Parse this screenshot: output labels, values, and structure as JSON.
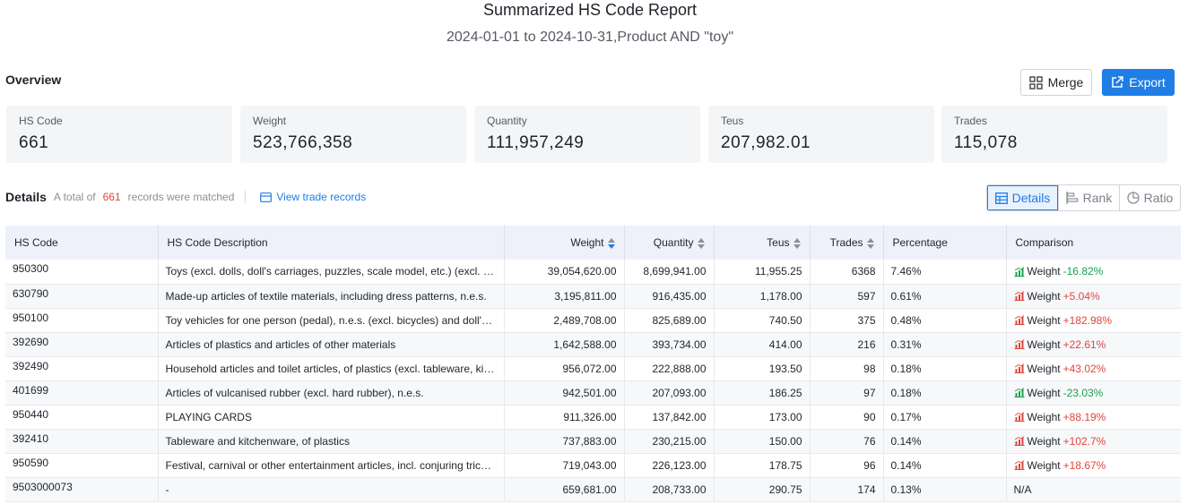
{
  "report": {
    "title": "Summarized HS Code Report",
    "subtitle": "2024-01-01 to 2024-10-31,Product AND \"toy\""
  },
  "overview": {
    "label": "Overview",
    "merge_label": "Merge",
    "export_label": "Export",
    "stats": [
      {
        "label": "HS Code",
        "value": "661"
      },
      {
        "label": "Weight",
        "value": "523,766,358"
      },
      {
        "label": "Quantity",
        "value": "111,957,249"
      },
      {
        "label": "Teus",
        "value": "207,982.01"
      },
      {
        "label": "Trades",
        "value": "115,078"
      }
    ]
  },
  "details": {
    "title": "Details",
    "total_prefix": "A total of",
    "total_count": "661",
    "total_suffix": "records were matched",
    "view_link": "View trade records",
    "views": [
      "Details",
      "Rank",
      "Ratio"
    ]
  },
  "table": {
    "headers": [
      "HS Code",
      "HS Code Description",
      "Weight",
      "Quantity",
      "Teus",
      "Trades",
      "Percentage",
      "Comparison"
    ],
    "rows": [
      {
        "code": "950300",
        "desc": "Toys (excl. dolls, doll's carriages, puzzles, scale model, etc.) (excl. games, etc.)",
        "weight": "39,054,620.00",
        "quantity": "8,699,941.00",
        "teus": "11,955.25",
        "trades": "6368",
        "pct": "7.46%",
        "cmp_label": "Weight",
        "cmp": "-16.82%",
        "trend": "down"
      },
      {
        "code": "630790",
        "desc": "Made-up articles of textile materials, including dress patterns, n.e.s.",
        "weight": "3,195,811.00",
        "quantity": "916,435.00",
        "teus": "1,178.00",
        "trades": "597",
        "pct": "0.61%",
        "cmp_label": "Weight",
        "cmp": "+5.04%",
        "trend": "up"
      },
      {
        "code": "950100",
        "desc": "Toy vehicles for one person (pedal), n.e.s. (excl. bicycles) and doll's carriages",
        "weight": "2,489,708.00",
        "quantity": "825,689.00",
        "teus": "740.50",
        "trades": "375",
        "pct": "0.48%",
        "cmp_label": "Weight",
        "cmp": "+182.98%",
        "trend": "up"
      },
      {
        "code": "392690",
        "desc": "Articles of plastics and articles of other materials",
        "weight": "1,642,588.00",
        "quantity": "393,734.00",
        "teus": "414.00",
        "trades": "216",
        "pct": "0.31%",
        "cmp_label": "Weight",
        "cmp": "+22.61%",
        "trend": "up"
      },
      {
        "code": "392490",
        "desc": "Household articles and toilet articles, of plastics (excl. tableware, kitchenware)",
        "weight": "956,072.00",
        "quantity": "222,888.00",
        "teus": "193.50",
        "trades": "98",
        "pct": "0.18%",
        "cmp_label": "Weight",
        "cmp": "+43.02%",
        "trend": "up"
      },
      {
        "code": "401699",
        "desc": "Articles of vulcanised rubber (excl. hard rubber), n.e.s.",
        "weight": "942,501.00",
        "quantity": "207,093.00",
        "teus": "186.25",
        "trades": "97",
        "pct": "0.18%",
        "cmp_label": "Weight",
        "cmp": "-23.03%",
        "trend": "down"
      },
      {
        "code": "950440",
        "desc": "PLAYING CARDS",
        "weight": "911,326.00",
        "quantity": "137,842.00",
        "teus": "173.00",
        "trades": "90",
        "pct": "0.17%",
        "cmp_label": "Weight",
        "cmp": "+88.19%",
        "trend": "up"
      },
      {
        "code": "392410",
        "desc": "Tableware and kitchenware, of plastics",
        "weight": "737,883.00",
        "quantity": "230,215.00",
        "teus": "150.00",
        "trades": "76",
        "pct": "0.14%",
        "cmp_label": "Weight",
        "cmp": "+102.7%",
        "trend": "up"
      },
      {
        "code": "950590",
        "desc": "Festival, carnival or other entertainment articles, incl. conjuring tricks and novelty jokes",
        "weight": "719,043.00",
        "quantity": "226,123.00",
        "teus": "178.75",
        "trades": "96",
        "pct": "0.14%",
        "cmp_label": "Weight",
        "cmp": "+18.67%",
        "trend": "up"
      },
      {
        "code": "9503000073",
        "desc": "-",
        "weight": "659,681.00",
        "quantity": "208,733.00",
        "teus": "290.75",
        "trades": "174",
        "pct": "0.13%",
        "cmp_label": "",
        "cmp": "N/A",
        "trend": "none"
      }
    ]
  },
  "colors": {
    "accent": "#1f7de6",
    "up": "#e0463c",
    "down": "#16a34a"
  }
}
